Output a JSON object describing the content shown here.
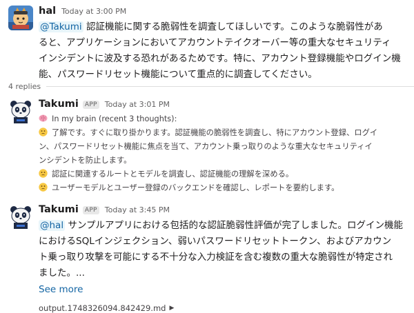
{
  "thread": {
    "parent": {
      "author": "hal",
      "time": "Today at 3:00 PM",
      "mention": "@Takumi",
      "lines": [
        " 認証機能に関する脆弱性を調査してほしいです。このような脆弱性があ",
        "ると、アプリケーションにおいてアカウントテイクオーバー等の重大なセキュリティ",
        "インシデントに波及する恐れがあるためです。特に、アカウント登録機能やログイン機",
        "能、パスワードリセット機能について重点的に調査してください。"
      ]
    },
    "replies_label": "4 replies",
    "reply1": {
      "author": "Takumi",
      "badge": "APP",
      "time": "Today at 3:01 PM",
      "brain_label": "In my brain (recent 3 thoughts):",
      "thoughts": [
        {
          "lines": [
            "了解です。すぐに取り掛かります。認証機能の脆弱性を調査し、特にアカウント登録、ログイ",
            "ン、パスワードリセット機能に焦点を当て、アカウント乗っ取りのような重大なセキュリティイ",
            "ンシデントを防止します。"
          ]
        },
        {
          "lines": [
            "認証に関連するルートとモデルを調査し、認証機能の理解を深める。"
          ]
        },
        {
          "lines": [
            "ユーザーモデルとユーザー登録のバックエンドを確認し、レポートを要約します。"
          ]
        }
      ]
    },
    "reply2": {
      "author": "Takumi",
      "badge": "APP",
      "time": "Today at 3:45 PM",
      "mention": "@hal",
      "lines": [
        " サンプルアプリにおける包括的な認証脆弱性評価が完了しました。ログイン機能",
        "におけるSQLインジェクション、弱いパスワードリセットトークン、およびアカウン",
        "ト乗っ取り攻撃を可能にする不十分な入力検証を含む複数の重大な脆弱性が特定され",
        "ました。..."
      ],
      "see_more": "See more",
      "file_name": "output.1748326094.842429.md"
    }
  },
  "icons": {
    "hal_avatar": "samurai-cat-avatar",
    "takumi_avatar": "panda-avatar",
    "brain": "brain-emoji",
    "thinking": "thinking-face-emoji",
    "play": "play-triangle-icon"
  },
  "colors": {
    "link": "#1264a3",
    "mention_bg": "#e8f5fa",
    "text": "#1d1c1d",
    "muted": "#616061"
  }
}
